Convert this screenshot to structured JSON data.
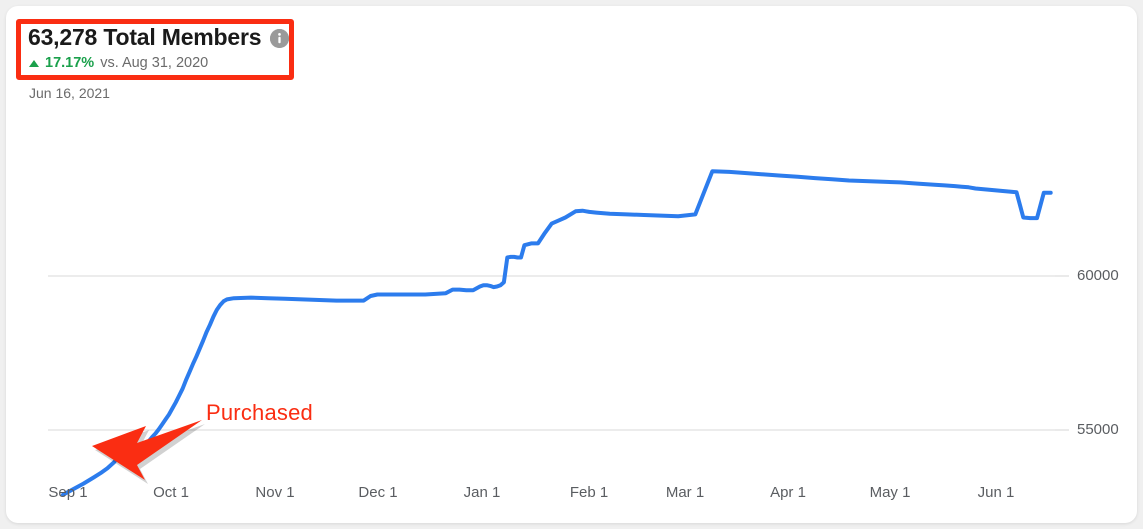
{
  "card": {
    "background": "#ffffff",
    "page_background": "#f0f0f0"
  },
  "header": {
    "kpi_value": "63,278 Total Members",
    "info_icon": "info-icon",
    "delta_arrow": "triangle-up-icon",
    "delta_percent": "17.17%",
    "delta_comparison": "vs. Aug 31, 2020",
    "as_of_date": "Jun 16, 2021",
    "highlight_color": "#fa2d12",
    "positive_color": "#1aa04b",
    "muted_color": "#6b6b6b"
  },
  "annotation": {
    "label": "Purchased",
    "color": "#fa2d12",
    "arrow_icon": "arrow-left-icon",
    "label_x": 200,
    "label_y": 396,
    "arrow_tip_x": 86,
    "arrow_tip_y": 440
  },
  "chart_data": {
    "type": "line",
    "title": "63,278 Total Members",
    "xlabel": "",
    "ylabel": "",
    "grid": true,
    "legend": false,
    "line_color": "#2c7ced",
    "line_width": 4,
    "xlim": [
      0,
      289
    ],
    "ylim": [
      52800,
      64200
    ],
    "y_ticks": [
      55000,
      60000
    ],
    "y_tick_labels": [
      "55000",
      "60000"
    ],
    "x_ticks": [
      0,
      30,
      61,
      91,
      122,
      153,
      181,
      212,
      242,
      273
    ],
    "x_tick_labels": [
      "Sep 1",
      "Oct 1",
      "Nov 1",
      "Dec 1",
      "Jan 1",
      "Feb 1",
      "Mar 1",
      "Apr 1",
      "May 1",
      "Jun 1"
    ],
    "series": [
      {
        "name": "Total Members",
        "x": [
          0,
          3,
          6,
          9,
          11,
          13,
          15,
          16,
          17,
          18,
          19,
          20,
          21,
          22,
          23,
          24,
          25,
          26,
          27,
          28,
          29,
          30,
          31,
          32,
          33,
          34,
          35,
          36,
          37,
          38,
          39,
          40,
          41,
          42,
          43,
          44,
          45,
          46,
          47,
          48,
          50,
          55,
          60,
          65,
          70,
          75,
          80,
          84,
          88,
          90,
          92,
          95,
          98,
          100,
          103,
          106,
          109,
          112,
          114,
          116,
          118,
          120,
          122,
          123,
          124,
          125,
          126,
          127,
          128,
          129,
          130,
          131,
          132,
          133,
          134,
          135,
          137,
          139,
          141,
          143,
          145,
          147,
          150,
          152,
          153,
          154,
          156,
          160,
          165,
          170,
          175,
          180,
          185,
          190,
          195,
          200,
          205,
          210,
          215,
          220,
          225,
          230,
          235,
          240,
          245,
          250,
          255,
          258,
          261,
          263,
          265,
          267,
          269,
          271,
          273,
          275,
          277,
          279,
          281,
          283,
          285,
          287,
          289
        ],
        "y": [
          52900,
          53080,
          53260,
          53460,
          53600,
          53760,
          53960,
          54120,
          54060,
          54160,
          54260,
          54200,
          54300,
          54420,
          54560,
          54500,
          54620,
          54760,
          54880,
          55020,
          55180,
          55340,
          55500,
          55700,
          55900,
          56120,
          56340,
          56620,
          56880,
          57140,
          57380,
          57640,
          57900,
          58180,
          58420,
          58680,
          58900,
          59060,
          59180,
          59240,
          59280,
          59300,
          59280,
          59260,
          59240,
          59220,
          59200,
          59200,
          59200,
          59350,
          59400,
          59400,
          59400,
          59400,
          59400,
          59400,
          59420,
          59440,
          59560,
          59560,
          59540,
          59540,
          59660,
          59700,
          59700,
          59680,
          59640,
          59660,
          59700,
          59800,
          60600,
          60620,
          60620,
          60600,
          60600,
          61000,
          61060,
          61060,
          61400,
          61700,
          61800,
          61900,
          62100,
          62120,
          62100,
          62080,
          62060,
          62020,
          62000,
          61980,
          61960,
          61940,
          62000,
          63400,
          63380,
          63340,
          63300,
          63260,
          63220,
          63180,
          63140,
          63100,
          63080,
          63060,
          63040,
          63000,
          62960,
          62940,
          62920,
          62900,
          62880,
          62840,
          62820,
          62800,
          62780,
          62760,
          62740,
          62720,
          61900,
          61880,
          61880,
          62700,
          62700
        ]
      }
    ],
    "features": {
      "plateau_start": "Oct 20",
      "big_step_jan": 63400,
      "late_dip_value": 61880,
      "final_value": 62700
    }
  }
}
